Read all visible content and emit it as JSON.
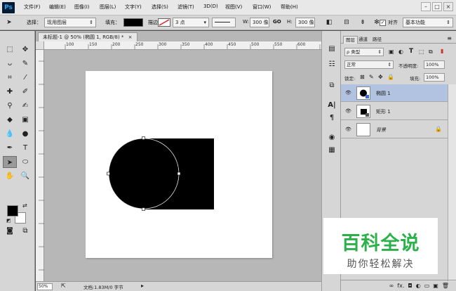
{
  "app": {
    "logo": "Ps"
  },
  "menu": [
    "文件(F)",
    "编辑(E)",
    "图像(I)",
    "图层(L)",
    "文字(Y)",
    "选择(S)",
    "滤镜(T)",
    "3D(D)",
    "视图(V)",
    "窗口(W)",
    "帮助(H)"
  ],
  "window_controls": {
    "minimize": "–",
    "maximize": "□",
    "close": "×"
  },
  "options": {
    "select_label": "选择：",
    "select_value": "现用图层",
    "fill_label": "填充：",
    "stroke_label": "描边：",
    "stroke_size": "3 点",
    "w_label": "W:",
    "w_value": "300 像",
    "link_icon": "GO",
    "h_label": "H:",
    "h_value": "300 像",
    "align_label": "对齐",
    "workspace": "基本功能"
  },
  "document": {
    "tab_title": "未标题-1 @ 50% (椭圆 1, RGB/8) *",
    "tab_close": "×",
    "ruler_ticks": [
      "100",
      "150",
      "200",
      "250",
      "300",
      "350",
      "400",
      "450",
      "500",
      "550",
      "600",
      "650"
    ],
    "zoom": "50%",
    "doc_info": "文档:1.83M/0 字节"
  },
  "layers_panel": {
    "tabs": [
      "图层",
      "通道",
      "路径"
    ],
    "filter_value": "ρ 类型",
    "blend_mode": "正常",
    "opacity_label": "不透明度:",
    "opacity_value": "100%",
    "lock_label": "锁定:",
    "fill_label": "填充:",
    "fill_value": "100%",
    "layers": [
      {
        "name": "椭圆 1",
        "selected": true
      },
      {
        "name": "矩形 1",
        "selected": false
      },
      {
        "name": "背景",
        "selected": false
      }
    ],
    "footer_icons": [
      "∞",
      "fx.",
      "◘",
      "◐",
      "▭",
      "▣",
      "🗑"
    ]
  },
  "watermark": {
    "title": "百科全说",
    "subtitle": "助你轻松解决"
  },
  "colors": {
    "fg": "#000000",
    "bg": "#ffffff",
    "selected_layer": "#b2c3e2",
    "watermark_green": "#2bb14a"
  }
}
